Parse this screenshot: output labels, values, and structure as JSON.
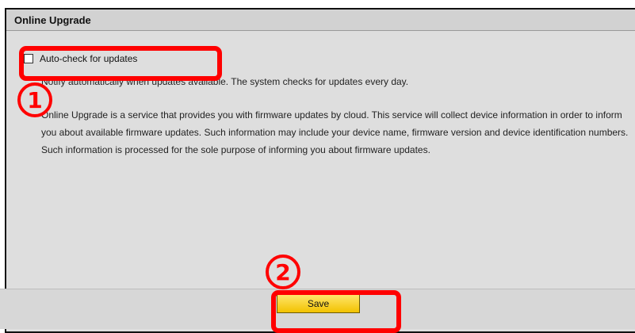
{
  "panel": {
    "title": "Online Upgrade",
    "auto_check": {
      "label": "Auto-check for updates",
      "checked": false
    },
    "notify_text": "Notify automatically when updates available. The system checks for updates every day.",
    "description": "Online Upgrade is a service that provides you with firmware updates by cloud. This service will collect device information in order to inform you about available firmware updates. Such information may include your device name, firmware version and device identification numbers. Such information is processed for the sole purpose of informing you about firmware updates."
  },
  "footer": {
    "save_label": "Save"
  },
  "annotations": {
    "step1": "1",
    "step2": "2",
    "highlight_color": "#ff0000"
  }
}
